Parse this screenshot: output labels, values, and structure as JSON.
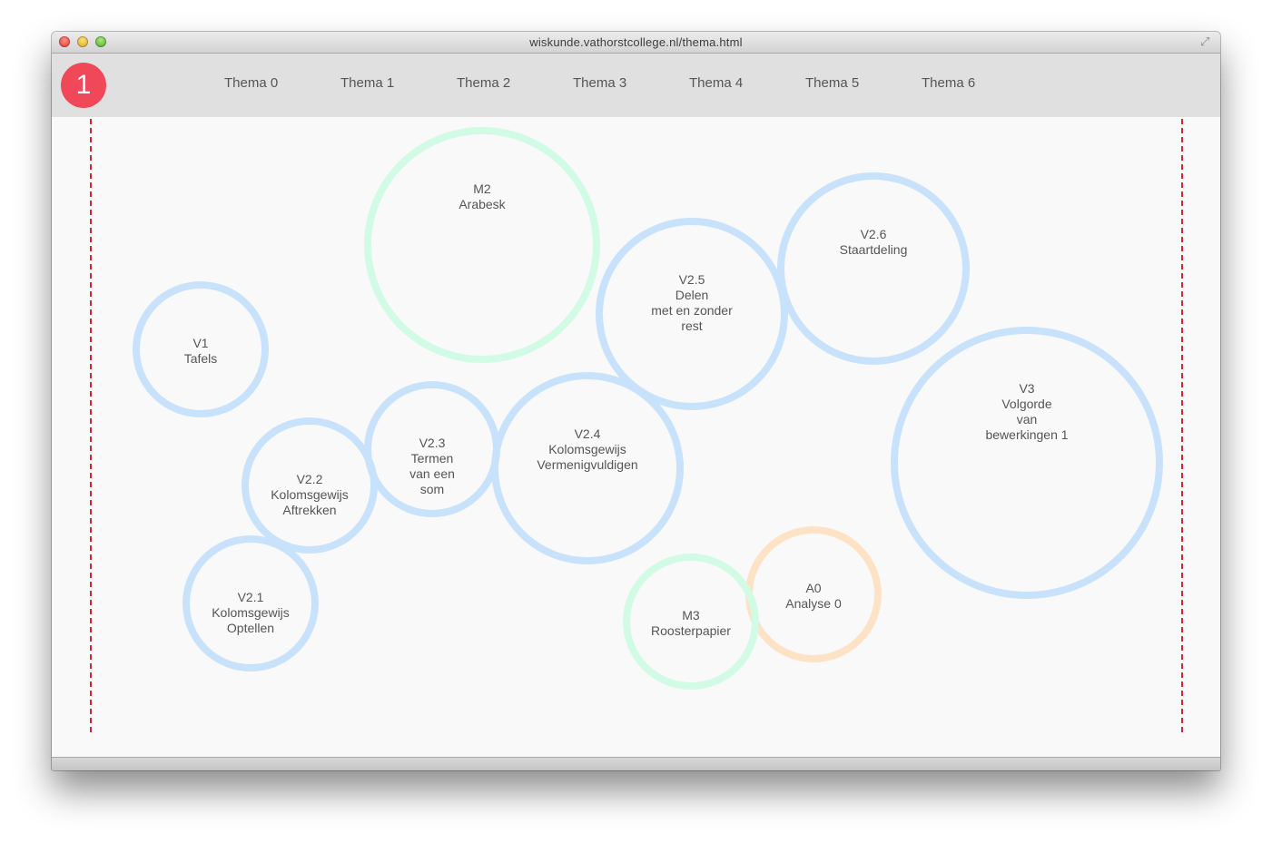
{
  "window": {
    "url": "wiskunde.vathorstcollege.nl/thema.html"
  },
  "logo": {
    "text": "1"
  },
  "nav": {
    "items": [
      {
        "label": "Thema 0"
      },
      {
        "label": "Thema 1"
      },
      {
        "label": "Thema 2"
      },
      {
        "label": "Thema 3"
      },
      {
        "label": "Thema 4"
      },
      {
        "label": "Thema 5"
      },
      {
        "label": "Thema 6"
      }
    ]
  },
  "colors": {
    "logo": "#f04759",
    "bubble_blue": "#c9e2fb",
    "bubble_green": "#d2fbe6",
    "bubble_orange": "#fde2c6",
    "guide_line": "#d9262c"
  },
  "bubbles": [
    {
      "code": "M2",
      "text": "Arabesk",
      "color": "green"
    },
    {
      "code": "V2.6",
      "text": "Staartdeling",
      "color": "blue"
    },
    {
      "code": "V2.5",
      "text": "Delen\nmet en zonder\nrest",
      "color": "blue"
    },
    {
      "code": "V1",
      "text": "Tafels",
      "color": "blue"
    },
    {
      "code": "V3",
      "text": "Volgorde\nvan\nbewerkingen 1",
      "color": "blue"
    },
    {
      "code": "V2.3",
      "text": "Termen\nvan een\nsom",
      "color": "blue"
    },
    {
      "code": "V2.4",
      "text": "Kolomsgewijs\nVermenigvuldigen",
      "color": "blue"
    },
    {
      "code": "V2.2",
      "text": "Kolomsgewijs\nAftrekken",
      "color": "blue"
    },
    {
      "code": "A0",
      "text": "Analyse 0",
      "color": "orange"
    },
    {
      "code": "M3",
      "text": "Roosterpapier",
      "color": "green"
    },
    {
      "code": "V2.1",
      "text": "Kolomsgewijs\nOptellen",
      "color": "blue"
    }
  ]
}
